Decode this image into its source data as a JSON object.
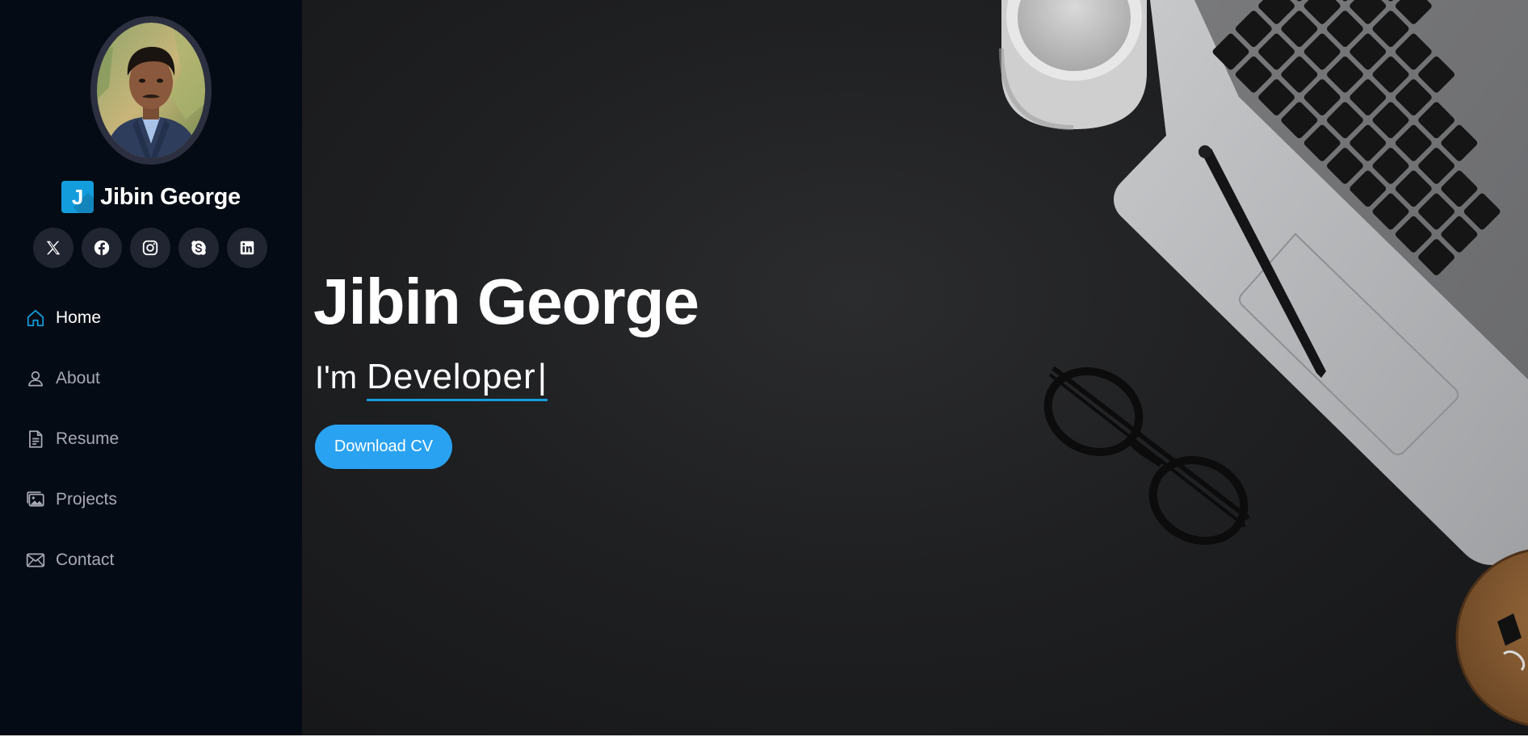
{
  "brand": {
    "logo_letter": "J",
    "name": "Jibin George"
  },
  "profile": {
    "avatar_icon": "profile-photo"
  },
  "socials": [
    {
      "name": "x-twitter",
      "icon": "x-icon"
    },
    {
      "name": "facebook",
      "icon": "facebook-icon"
    },
    {
      "name": "instagram",
      "icon": "instagram-icon"
    },
    {
      "name": "skype",
      "icon": "skype-icon"
    },
    {
      "name": "linkedin",
      "icon": "linkedin-icon"
    }
  ],
  "nav": {
    "items": [
      {
        "label": "Home",
        "icon": "home-icon",
        "active": true
      },
      {
        "label": "About",
        "icon": "person-icon",
        "active": false
      },
      {
        "label": "Resume",
        "icon": "document-icon",
        "active": false
      },
      {
        "label": "Projects",
        "icon": "images-icon",
        "active": false
      },
      {
        "label": "Contact",
        "icon": "envelope-icon",
        "active": false
      }
    ]
  },
  "hero": {
    "title": "Jibin George",
    "prefix": "I'm",
    "typed_text": "Developer",
    "caret": "|",
    "button_label": "Download CV"
  },
  "colors": {
    "accent": "#149ddd",
    "button": "#2aa2f2",
    "sidebar_bg": "#040b14",
    "social_bg": "#212431",
    "nav_inactive": "#a8a9b4",
    "nav_active_icon": "#149ddd"
  }
}
